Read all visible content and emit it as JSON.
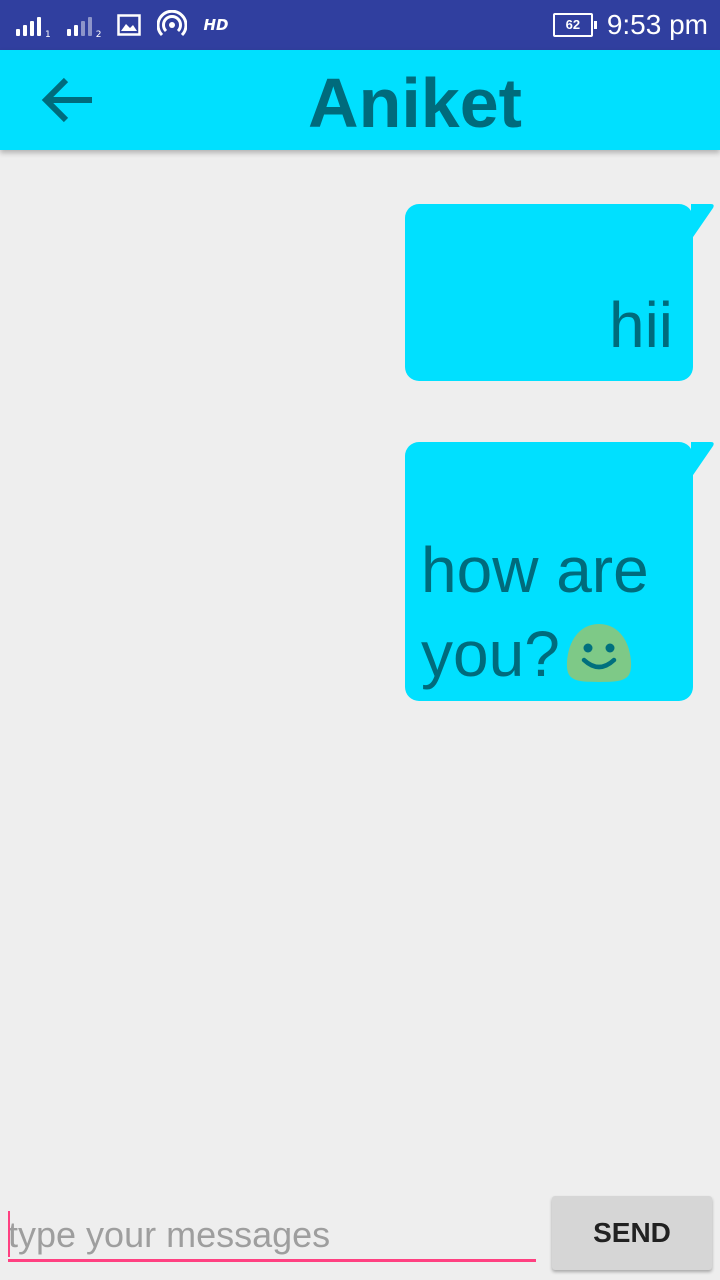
{
  "status_bar": {
    "sim1_label": "1",
    "sim2_label": "2",
    "hd_label": "HD",
    "battery_level": "62",
    "time": "9:53 pm",
    "icons": [
      "signal-sim1-icon",
      "signal-sim2-icon",
      "gallery-icon",
      "hotspot-icon",
      "battery-icon"
    ]
  },
  "app_bar": {
    "title": "Aniket",
    "back_icon": "arrow-back-icon",
    "background": "#00e0ff",
    "title_color": "#006b7c"
  },
  "messages": [
    {
      "text": "hii",
      "direction": "outgoing"
    },
    {
      "text": "how are you?",
      "emoji": "smiley-face-icon",
      "direction": "outgoing"
    }
  ],
  "composer": {
    "placeholder": "type your messages",
    "value": "",
    "send_label": "SEND",
    "accent": "#ff4081"
  },
  "colors": {
    "status_bar": "#303f9f",
    "background": "#eeeeee",
    "bubble": "#00e0ff"
  }
}
